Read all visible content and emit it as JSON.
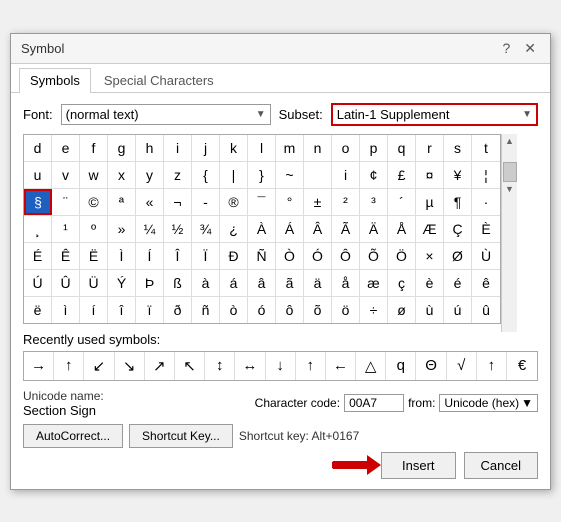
{
  "title": "Symbol",
  "titlebar": {
    "help_btn": "?",
    "close_btn": "✕"
  },
  "tabs": [
    {
      "id": "symbols",
      "label": "Symbols",
      "active": false
    },
    {
      "id": "special-chars",
      "label": "Special Characters",
      "active": false
    }
  ],
  "font_label": "Font:",
  "font_value": "(normal text)",
  "subset_label": "Subset:",
  "subset_value": "Latin-1 Supplement",
  "symbol_grid": [
    [
      "d",
      "e",
      "f",
      "g",
      "h",
      "i",
      "j",
      "k",
      "l",
      "m",
      "n",
      "o",
      "p",
      "q",
      "r",
      "s",
      "t"
    ],
    [
      "u",
      "v",
      "w",
      "x",
      "y",
      "z",
      "{",
      "|",
      "}",
      "~",
      "",
      "i",
      "¢",
      "£",
      "¤",
      "¥",
      "¦"
    ],
    [
      "§",
      "¨",
      "©",
      "ª",
      "«",
      "¬",
      "-",
      "®",
      "¯",
      "°",
      "±",
      "²",
      "³",
      "´",
      "µ",
      "¶",
      "·"
    ],
    [
      "¸",
      "¹",
      "º",
      "»",
      "¼",
      "½",
      "¾",
      "¿",
      "À",
      "Á",
      "Â",
      "Ã",
      "Ä",
      "Å",
      "Æ",
      "Ç",
      "È"
    ],
    [
      "É",
      "Ê",
      "Ë",
      "Ì",
      "Í",
      "Î",
      "Ï",
      "Ð",
      "Ñ",
      "Ò",
      "Ó",
      "Ô",
      "Õ",
      "Ö",
      "×",
      "Ø",
      "Ù"
    ],
    [
      "Ú",
      "Û",
      "Ü",
      "Ý",
      "Þ",
      "ß",
      "à",
      "á",
      "â",
      "ã",
      "ä",
      "å",
      "æ",
      "ç",
      "è",
      "é",
      "ê"
    ],
    [
      "ë",
      "ì",
      "í",
      "î",
      "ï",
      "ð",
      "ñ",
      "ò",
      "ó",
      "ô",
      "õ",
      "ö",
      "÷",
      "ø",
      "ù",
      "ú",
      "û"
    ]
  ],
  "selected_cell": {
    "row": 2,
    "col": 0
  },
  "recently_used_label": "Recently used symbols:",
  "recent_symbols": [
    "→",
    "↑",
    "↙",
    "↘",
    "↗",
    "↖",
    "↕",
    "↔",
    "↓",
    "↑",
    "←",
    "△",
    "q",
    "Θ",
    "√",
    "↑",
    "€"
  ],
  "unicode_name_label": "Unicode name:",
  "unicode_name_value": "Section Sign",
  "character_code_label": "Character code:",
  "character_code_value": "00A7",
  "from_label": "from:",
  "from_value": "Unicode (hex)",
  "autocorrect_btn": "AutoCorrect...",
  "shortcut_key_btn": "Shortcut Key...",
  "shortcut_key_info": "Shortcut key: Alt+0167",
  "insert_btn": "Insert",
  "cancel_btn": "Cancel"
}
